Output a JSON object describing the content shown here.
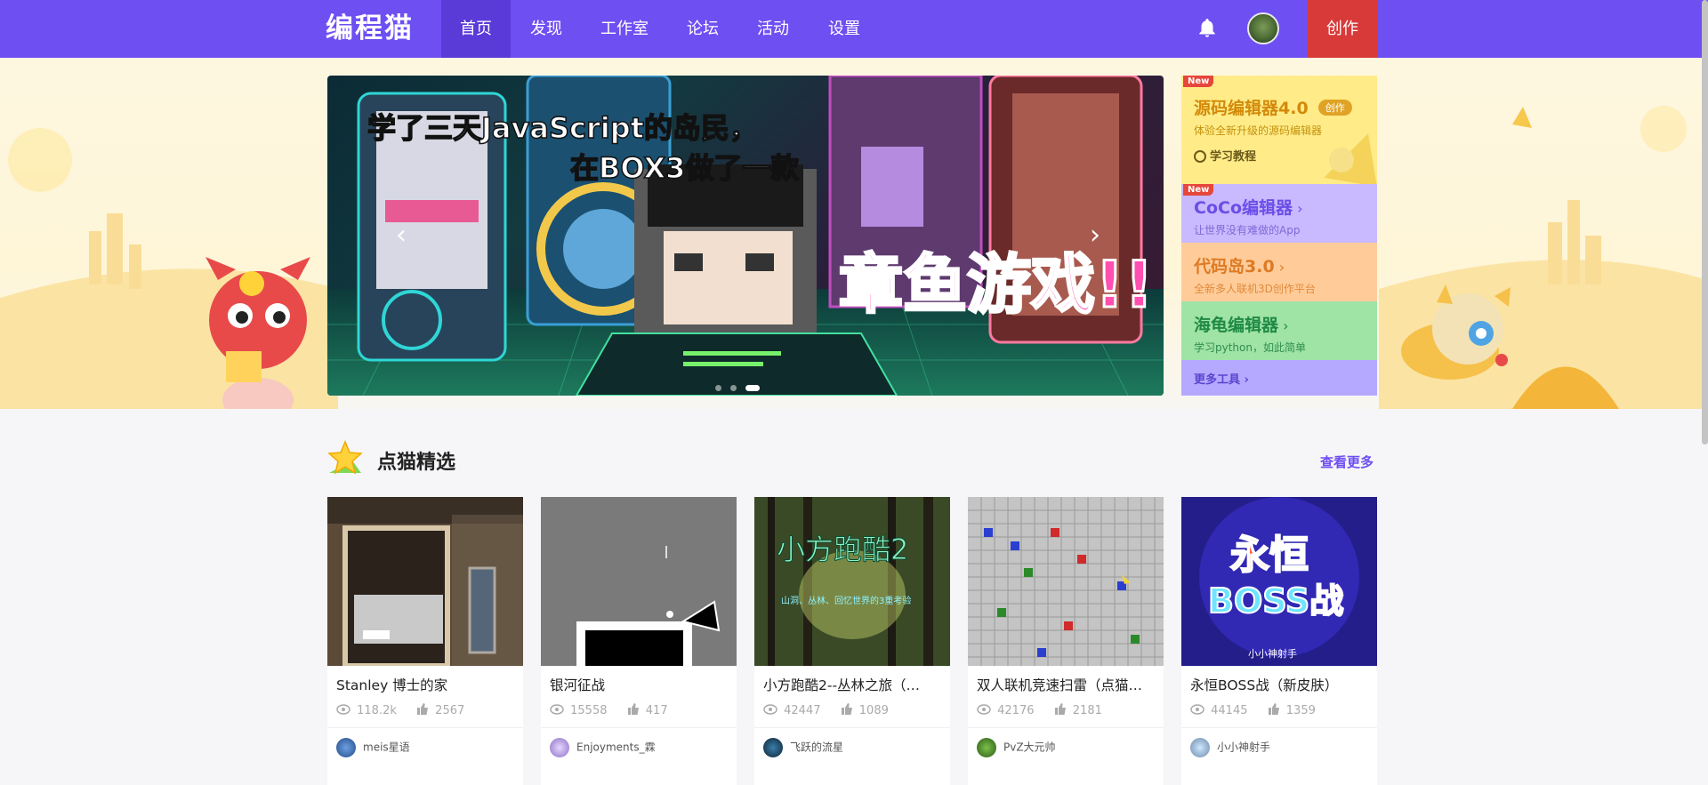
{
  "header": {
    "logo": "编程猫",
    "nav": [
      "首页",
      "发现",
      "工作室",
      "论坛",
      "活动",
      "设置"
    ],
    "create_label": "创作"
  },
  "banner": {
    "line1": "学了三天JavaScript的岛民，",
    "line2": "在BOX3做了一款",
    "big": "章鱼游戏!!",
    "prev": "‹",
    "next": "›"
  },
  "tools": [
    {
      "name": "源码编辑器4.0",
      "badge": "New",
      "tag": "创作",
      "desc": "体验全新升级的源码编辑器",
      "link": "学习教程"
    },
    {
      "name": "CoCo编辑器",
      "badge": "New",
      "desc": "让世界没有难做的App"
    },
    {
      "name": "代码岛3.0",
      "desc": "全新多人联机3D创作平台"
    },
    {
      "name": "海龟编辑器",
      "desc": "学习python，如此简单"
    },
    {
      "name": "更多工具"
    }
  ],
  "section": {
    "title": "点猫精选",
    "more": "查看更多"
  },
  "cards": [
    {
      "title": "Stanley 博士的家",
      "views": "118.2k",
      "likes": "2567",
      "author": "meis星语"
    },
    {
      "title": "银河征战",
      "views": "15558",
      "likes": "417",
      "author": "Enjoyments_霖"
    },
    {
      "title": "小方跑酷2--丛林之旅（…",
      "views": "42447",
      "likes": "1089",
      "author": "飞跃的流星"
    },
    {
      "title": "双人联机竞速扫雷（点猫…",
      "views": "42176",
      "likes": "2181",
      "author": "PvZ大元帅"
    },
    {
      "title": "永恒BOSS战（新皮肤）",
      "views": "44145",
      "likes": "1359",
      "author": "小小神射手"
    }
  ],
  "thumbs": {
    "c3_title": "小方跑酷2",
    "c3_sub": "山洞、丛林、回忆世界的3重考验",
    "c5_line1": "永恒",
    "c5_line2": "BOSS战",
    "c5_author": "小小神射手"
  },
  "colors": {
    "brand": "#6e4ff2",
    "create": "#d83a3a"
  }
}
